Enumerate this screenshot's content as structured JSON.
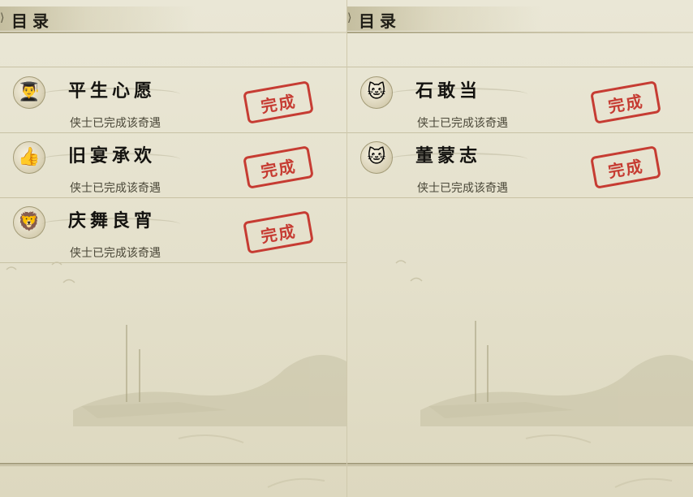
{
  "left_panel": {
    "title": "目录",
    "entries": [
      {
        "name": "平生心愿",
        "status": "侠士已完成该奇遇",
        "stamp": "完成",
        "icon": "scholar-avatar-icon"
      },
      {
        "name": "旧宴承欢",
        "status": "侠士已完成该奇遇",
        "stamp": "完成",
        "icon": "thumbs-up-icon"
      },
      {
        "name": "庆舞良宵",
        "status": "侠士已完成该奇遇",
        "stamp": "完成",
        "icon": "lion-dance-icon"
      }
    ]
  },
  "right_panel": {
    "title": "目录",
    "entries": [
      {
        "name": "石敢当",
        "status": "侠士已完成该奇遇",
        "stamp": "完成",
        "icon": "cat-avatar-icon"
      },
      {
        "name": "董蒙志",
        "status": "侠士已完成该奇遇",
        "stamp": "完成",
        "icon": "cat-avatar-icon"
      }
    ]
  },
  "colors": {
    "stamp": "#c32a22",
    "paper": "#e6e2cf",
    "ink": "#141310"
  }
}
